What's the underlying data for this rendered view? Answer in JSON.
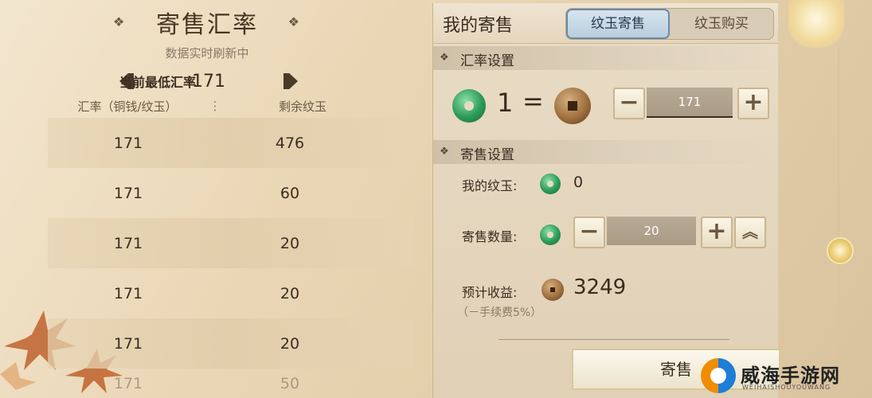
{
  "left": {
    "title": "寄售汇率",
    "subtitle": "数据实时刷新中",
    "min_rate_label": "当前最低汇率",
    "min_rate_value": "171",
    "columns": [
      "汇率（铜钱/纹玉）",
      "剩余纹玉"
    ],
    "rows": [
      {
        "rate": "171",
        "remaining": "476"
      },
      {
        "rate": "171",
        "remaining": "60"
      },
      {
        "rate": "171",
        "remaining": "20"
      },
      {
        "rate": "171",
        "remaining": "20"
      },
      {
        "rate": "171",
        "remaining": "20"
      },
      {
        "rate": "171",
        "remaining": "50"
      }
    ]
  },
  "right": {
    "title": "我的寄售",
    "tabs": [
      {
        "label": "纹玉寄售",
        "active": true
      },
      {
        "label": "纹玉购买",
        "active": false
      }
    ],
    "rate_section": {
      "title": "汇率设置",
      "lhs": "1",
      "equals": "=",
      "value": "171"
    },
    "sell_section": {
      "title": "寄售设置",
      "my_jade_label": "我的纹玉:",
      "my_jade_value": "0",
      "quantity_label": "寄售数量:",
      "quantity_value": "20",
      "income_label": "预计收益:",
      "income_value": "3249",
      "fee_note": "（－手续费5%）"
    },
    "sell_button": "寄售"
  },
  "watermark": {
    "text": "威海手游网",
    "sub": "WEIHAISHOUYOUWANG"
  },
  "colors": {
    "background": "#ead7b6",
    "accent_tab": "#b8ccdc",
    "jade": "#2c9a58",
    "coin": "#9a6a3a"
  }
}
